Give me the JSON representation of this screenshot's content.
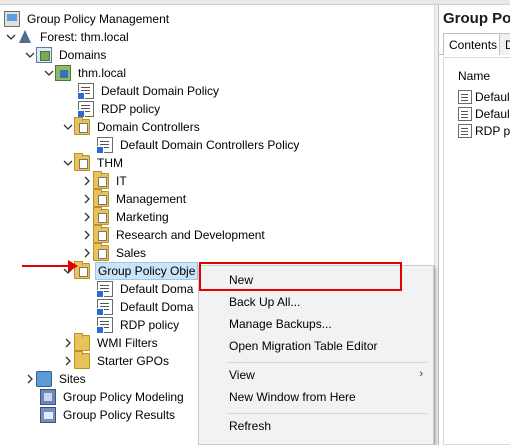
{
  "tree": {
    "root": {
      "label": "Group Policy Management",
      "icon": "gpm-icon"
    },
    "forest": {
      "label": "Forest: thm.local",
      "icon": "forest-icon"
    },
    "domains": {
      "label": "Domains",
      "icon": "domains-icon"
    },
    "domain": {
      "label": "thm.local",
      "icon": "domain-icon"
    },
    "linked": [
      {
        "label": "Default Domain Policy"
      },
      {
        "label": "RDP policy"
      }
    ],
    "domain_controllers": {
      "label": "Domain Controllers"
    },
    "dc_policy": {
      "label": "Default Domain Controllers Policy"
    },
    "thm": {
      "label": "THM"
    },
    "ous": [
      {
        "label": "IT"
      },
      {
        "label": "Management"
      },
      {
        "label": "Marketing"
      },
      {
        "label": "Research and Development"
      },
      {
        "label": "Sales"
      }
    ],
    "gpo_container": {
      "label": "Group Policy Obje"
    },
    "gpos": [
      {
        "label": "Default Doma"
      },
      {
        "label": "Default Doma"
      },
      {
        "label": "RDP policy"
      }
    ],
    "wmi": {
      "label": "WMI Filters"
    },
    "starter": {
      "label": "Starter GPOs"
    },
    "sites": {
      "label": "Sites"
    },
    "modeling": {
      "label": "Group Policy Modeling"
    },
    "results": {
      "label": "Group Policy Results"
    }
  },
  "right_pane": {
    "title": "Group Polic",
    "tabs": [
      "Contents",
      "D"
    ],
    "column": "Name",
    "items": [
      "Default",
      "Default",
      "RDP polic"
    ]
  },
  "context_menu": {
    "items": {
      "new": "New",
      "backup_all": "Back Up All...",
      "manage_backups": "Manage Backups...",
      "migration": "Open Migration Table Editor",
      "view": "View",
      "new_window": "New Window from Here",
      "refresh": "Refresh"
    },
    "submenu_arrow": "›"
  },
  "annotations": {
    "highlight_color": "#e00000",
    "arrow_color": "#e00000"
  }
}
